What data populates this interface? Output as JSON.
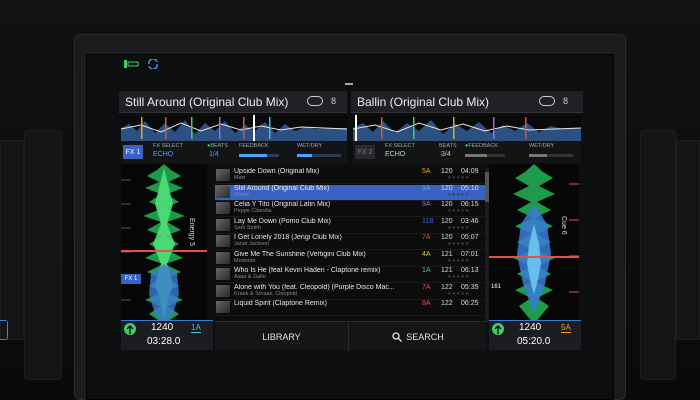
{
  "colors": {
    "accent_blue": "#3a62c4",
    "key_orange": "#f0a020",
    "key_red": "#e0524a",
    "key_green": "#3ecf6a",
    "key_cyan": "#3fc1d6",
    "key_yellow": "#d8c93a",
    "key_violet": "#9b6ae0"
  },
  "top_status": {
    "left_icon": "battery-icon",
    "sync_icon": "sync-icon"
  },
  "deck_left": {
    "title": "Still Around (Original Club Mix)",
    "loop_count": "8",
    "fx_button": "FX 1",
    "fx_select_label": "FX SELECT",
    "fx_name": "ECHO",
    "beats_label": "BEATS",
    "beats_value": "1/4",
    "feedback_label": "FEEDBACK",
    "wetdry_label": "WET/DRY",
    "wave_tag": "FX 1",
    "energy_label": "Energy 5",
    "bpm": "1240",
    "time": "03:28.0",
    "key": "1A"
  },
  "deck_right": {
    "title": "Ballin (Original Club Mix)",
    "loop_count": "8",
    "fx_button": "FX 2",
    "fx_select_label": "FX SELECT",
    "fx_name": "ECHO",
    "beats_label": "BEATS",
    "beats_value": "3/4",
    "feedback_label": "FEEDBACK",
    "wetdry_label": "WET/DRY",
    "cue_label": "Cue 6",
    "marker": "161",
    "bpm": "1240",
    "time": "05:20.0",
    "key": "5A"
  },
  "library": {
    "tracks": [
      {
        "title": "Upside Down (Original Mix)",
        "artist": "Mart",
        "key": "5A",
        "key_color": "#f0a020",
        "bpm": "120",
        "time": "04:09",
        "stars": "★★★★★"
      },
      {
        "title": "Still Around (Original Club Mix)",
        "artist": "Mixtek",
        "key": "1A",
        "key_color": "#3fc1d6",
        "bpm": "120",
        "time": "05:10",
        "stars": "★★★★★",
        "selected": true
      },
      {
        "title": "Celia Y Tito (Original Latin Mix)",
        "artist": "Peppe Citarella",
        "key": "9A",
        "key_color": "#9b6ae0",
        "bpm": "120",
        "time": "06:15",
        "stars": "★★★★★"
      },
      {
        "title": "Lay Me Down (Pomo Club Mix)",
        "artist": "Sam Smith",
        "key": "11B",
        "key_color": "#3a62c4",
        "bpm": "120",
        "time": "03:46",
        "stars": "★★★★★"
      },
      {
        "title": "I Get Lonely 2018 (Jengi Club Mix)",
        "artist": "Janet Jackson",
        "key": "7A",
        "key_color": "#e0524a",
        "bpm": "120",
        "time": "05:07",
        "stars": "★★★★★"
      },
      {
        "title": "Give Me The Sunshine (Vertigini Club Mix)",
        "artist": "Modento",
        "key": "4A",
        "key_color": "#d8c93a",
        "bpm": "121",
        "time": "07:01",
        "stars": "★★★★★"
      },
      {
        "title": "Who Is He (feat Kevin Haden - Claptone remix)",
        "artist": "Alaia & Gallo",
        "key": "1A",
        "key_color": "#3ecf6a",
        "bpm": "121",
        "time": "06:13",
        "stars": "★★★★★"
      },
      {
        "title": "Alone with You (feat. Cleopold) (Purple Disco Mac...",
        "artist": "Kraak & Smaak, Cleopold",
        "key": "7A",
        "key_color": "#e0524a",
        "bpm": "122",
        "time": "05:35",
        "stars": "★★★★★"
      },
      {
        "title": "Liquid Spirit (Claptone Remix)",
        "artist": "",
        "key": "8A",
        "key_color": "#e0524a",
        "bpm": "122",
        "time": "06:25",
        "stars": ""
      }
    ]
  },
  "bottom": {
    "library_label": "LIBRARY",
    "search_label": "SEARCH",
    "search_icon": "search-icon"
  }
}
